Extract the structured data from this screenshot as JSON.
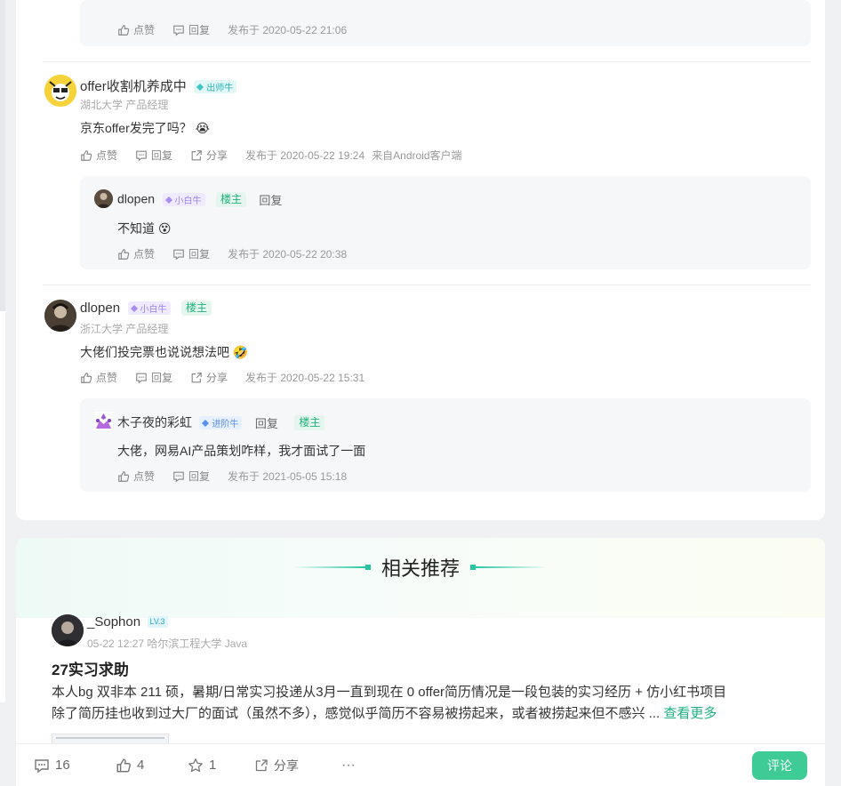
{
  "colors": {
    "accent": "#3fcb96",
    "lou_green": "#20b27f",
    "reply_bg": "#f6f7f9"
  },
  "top_reply": {
    "actions": {
      "like": "点赞",
      "reply": "回复"
    },
    "time": "发布于 2020-05-22 21:06"
  },
  "comments": [
    {
      "user": "offer收割机养成中",
      "badge": "出师牛",
      "school": "湖北大学 产品经理",
      "text": "京东offer发完了吗？",
      "emoji": "😭",
      "actions": {
        "like": "点赞",
        "reply": "回复",
        "share": "分享"
      },
      "time": "发布于 2020-05-22 19:24",
      "source": "来自Android客户端",
      "reply": {
        "user": "dlopen",
        "badge": "小白牛",
        "owner_tag": "楼主",
        "reply_label": "回复",
        "text": "不知道",
        "emoji": "😵",
        "actions": {
          "like": "点赞",
          "reply": "回复"
        },
        "time": "发布于 2020-05-22 20:38"
      }
    },
    {
      "user": "dlopen",
      "badge": "小白牛",
      "owner_tag": "楼主",
      "school": "浙江大学 产品经理",
      "text": "大佬们投完票也说说想法吧",
      "emoji": "🤣",
      "actions": {
        "like": "点赞",
        "reply": "回复",
        "share": "分享"
      },
      "time": "发布于 2020-05-22 15:31",
      "reply": {
        "user": "木子夜的彩虹",
        "badge": "进阶牛",
        "reply_label": "回复",
        "owner_tag": "楼主",
        "text": "大佬，网易AI产品策划咋样，我才面试了一面",
        "actions": {
          "like": "点赞",
          "reply": "回复"
        },
        "time": "发布于 2021-05-05 15:18"
      }
    }
  ],
  "related": {
    "heading": "相关推荐",
    "post": {
      "user": "_Sophon",
      "level": "LV.3",
      "meta": "05-22 12:27  哈尔滨工程大学 Java",
      "title": "27实习求助",
      "line1": "本人bg 双非本 211 硕，暑期/日常实习投递从3月一直到现在 0 offer简历情况是一段包装的实习经历 + 仿小红书项目",
      "line2": "除了简历挂也收到过大厂的面试（虽然不多），感觉似乎简历不容易被捞起来，或者被捞起来但不感兴 ...",
      "more": "查看更多"
    }
  },
  "bottom_bar": {
    "comments": "16",
    "likes": "4",
    "stars": "1",
    "share": "分享",
    "more": "···",
    "comment_button": "评论"
  }
}
